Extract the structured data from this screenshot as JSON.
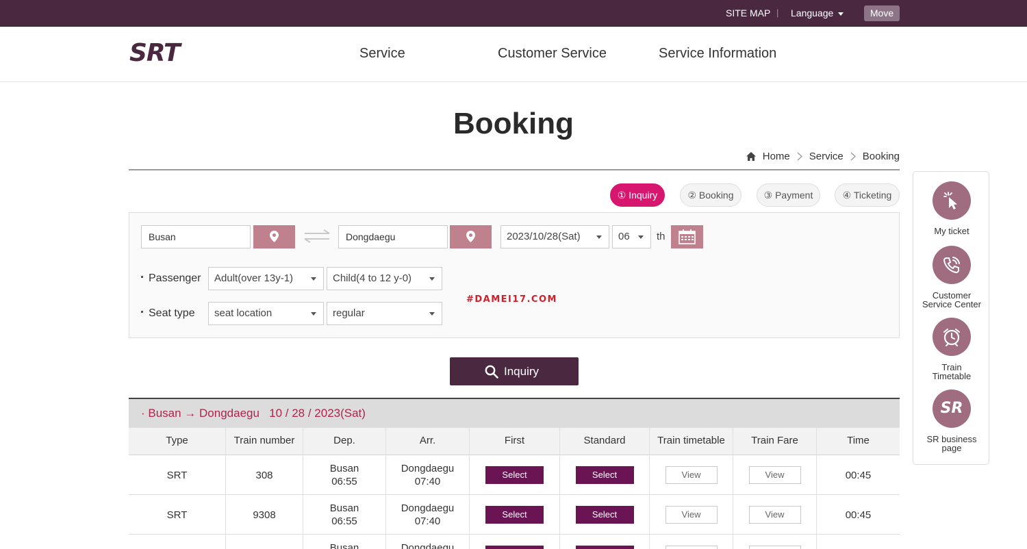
{
  "topbar": {
    "sitemap": "SITE MAP",
    "separator": "|",
    "language": "Language",
    "move": "Move"
  },
  "header": {
    "logo_text": "SRT",
    "nav": [
      "Service",
      "Customer Service",
      "Service Information"
    ]
  },
  "page_title": "Booking",
  "breadcrumb": [
    "Home",
    "Service",
    "Booking"
  ],
  "steps": [
    "① Inquiry",
    "② Booking",
    "③ Payment",
    "④ Ticketing"
  ],
  "search": {
    "departure": "Busan",
    "arrival": "Dongdaegu",
    "date": "2023/10/28(Sat)",
    "hour": "06",
    "hour_suffix": "th",
    "passenger_label": "Passenger",
    "adult": "Adult(over 13y-1)",
    "child": "Child(4 to 12 y-0)",
    "seat_label": "Seat type",
    "seat_location": "seat location",
    "seat_class": "regular",
    "inquiry_button": "Inquiry"
  },
  "watermark": "#DAMEI17.COM",
  "results": {
    "route": "· Busan → Dongdaegu",
    "date": "10 / 28 / 2023(Sat)",
    "columns": [
      "Type",
      "Train number",
      "Dep.",
      "Arr.",
      "First",
      "Standard",
      "Train timetable",
      "Train Fare",
      "Time"
    ],
    "select_label": "Select",
    "view_label": "View",
    "rows": [
      {
        "type": "SRT",
        "train": "308",
        "dep_station": "Busan",
        "dep_time": "06:55",
        "arr_station": "Dongdaegu",
        "arr_time": "07:40",
        "time": "00:45"
      },
      {
        "type": "SRT",
        "train": "9308",
        "dep_station": "Busan",
        "dep_time": "06:55",
        "arr_station": "Dongdaegu",
        "arr_time": "07:40",
        "time": "00:45"
      },
      {
        "type": "",
        "train": "",
        "dep_station": "Busan",
        "dep_time": "",
        "arr_station": "Dongdaegu",
        "arr_time": "",
        "time": ""
      }
    ]
  },
  "quick_menu": [
    {
      "label_1": "My ticket",
      "label_2": "",
      "icon": "cursor-click-icon"
    },
    {
      "label_1": "Customer",
      "label_2": "Service Center",
      "icon": "phone-icon"
    },
    {
      "label_1": "Train",
      "label_2": "Timetable",
      "icon": "clock-icon"
    },
    {
      "label_1": "SR business",
      "label_2": "page",
      "icon": "sr-logo-icon",
      "badge": "SR"
    }
  ],
  "colors": {
    "brand": "#4a2840",
    "accent": "#d6166f",
    "select": "#6b1454",
    "pin": "#c0818f",
    "route_text": "#b0244e"
  }
}
